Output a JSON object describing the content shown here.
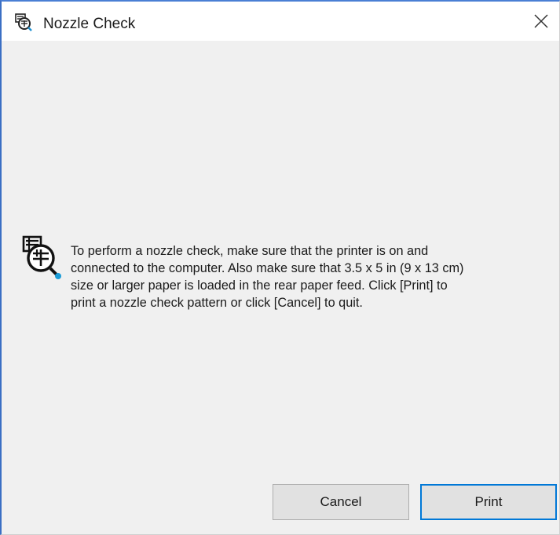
{
  "window": {
    "title": "Nozzle Check",
    "title_icon": "printer-check-icon",
    "close_icon": "close-icon"
  },
  "message": {
    "icon": "nozzle-check-icon",
    "lines": [
      "To perform a nozzle check, make sure that the printer is on and",
      "connected to the computer. Also make sure that 3.5 x 5 in (9 x 13 cm)",
      "size or larger paper is loaded in the rear paper feed. Click [Print] to",
      "print a nozzle check pattern or click [Cancel] to quit."
    ]
  },
  "buttons": {
    "cancel_label": "Cancel",
    "print_label": "Print"
  },
  "colors": {
    "window_border": "#3b6fc4",
    "default_button_border": "#0078d7",
    "dialog_background": "#f0f0f0"
  }
}
